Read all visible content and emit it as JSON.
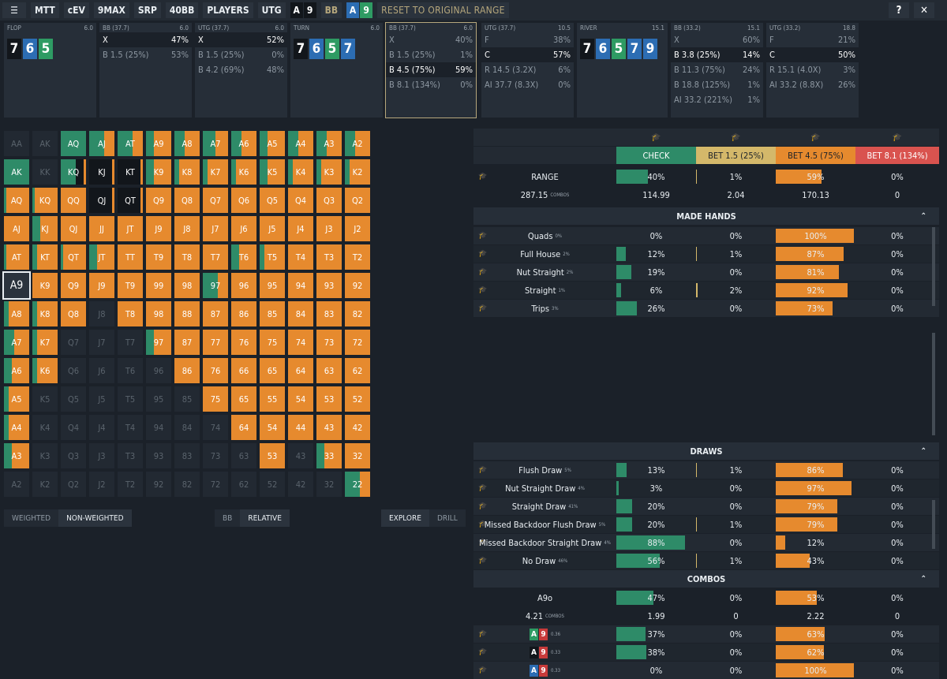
{
  "toolbar": {
    "menu_icon": "menu-icon",
    "buttons": [
      "MTT",
      "cEV",
      "9MAX",
      "SRP",
      "40BB",
      "PLAYERS",
      "UTG"
    ],
    "hand": [
      {
        "r": "A",
        "s": "s"
      },
      {
        "r": "9",
        "s": "s"
      }
    ],
    "pos2": "BB",
    "hand2": [
      {
        "r": "A",
        "s": "d"
      },
      {
        "r": "9",
        "s": "c"
      }
    ],
    "reset": "RESET TO ORIGINAL RANGE",
    "help": "?",
    "close": "✕"
  },
  "streets": [
    {
      "name": "FLOP",
      "val": "6.0",
      "cards": [
        {
          "r": "7",
          "s": "s"
        },
        {
          "r": "6",
          "s": "d"
        },
        {
          "r": "5",
          "s": "c"
        }
      ]
    },
    {
      "name": "BB (37.7)",
      "val": "6.0",
      "actions": [
        {
          "l": "X",
          "v": "47%",
          "sel": true
        },
        {
          "l": "B 1.5 (25%)",
          "v": "53%"
        }
      ]
    },
    {
      "name": "UTG (37.7)",
      "val": "6.0",
      "actions": [
        {
          "l": "X",
          "v": "52%",
          "sel": true
        },
        {
          "l": "B 1.5 (25%)",
          "v": "0%"
        },
        {
          "l": "B 4.2 (69%)",
          "v": "48%"
        }
      ]
    },
    {
      "name": "TURN",
      "val": "6.0",
      "cards": [
        {
          "r": "7",
          "s": "s"
        },
        {
          "r": "6",
          "s": "d"
        },
        {
          "r": "5",
          "s": "c"
        },
        {
          "r": "7",
          "s": "d"
        }
      ]
    },
    {
      "name": "BB (37.7)",
      "val": "6.0",
      "actions": [
        {
          "l": "X",
          "v": "40%"
        },
        {
          "l": "B 1.5 (25%)",
          "v": "1%"
        },
        {
          "l": "B 4.5 (75%)",
          "v": "59%",
          "sel": true
        },
        {
          "l": "B 8.1 (134%)",
          "v": "0%"
        }
      ]
    },
    {
      "name": "UTG (37.7)",
      "val": "10.5",
      "actions": [
        {
          "l": "F",
          "v": "38%"
        },
        {
          "l": "C",
          "v": "57%",
          "sel": true
        },
        {
          "l": "R 14.5 (3.2X)",
          "v": "6%"
        },
        {
          "l": "AI 37.7 (8.3X)",
          "v": "0%"
        }
      ]
    },
    {
      "name": "RIVER",
      "val": "15.1",
      "cards": [
        {
          "r": "7",
          "s": "s"
        },
        {
          "r": "6",
          "s": "d"
        },
        {
          "r": "5",
          "s": "c"
        },
        {
          "r": "7",
          "s": "d"
        },
        {
          "r": "9",
          "s": "d"
        }
      ]
    },
    {
      "name": "BB (33.2)",
      "val": "15.1",
      "actions": [
        {
          "l": "X",
          "v": "60%"
        },
        {
          "l": "B 3.8 (25%)",
          "v": "14%",
          "sel": true
        },
        {
          "l": "B 11.3 (75%)",
          "v": "24%"
        },
        {
          "l": "B 18.8 (125%)",
          "v": "1%"
        },
        {
          "l": "AI 33.2 (221%)",
          "v": "1%"
        }
      ]
    },
    {
      "name": "UTG (33.2)",
      "val": "18.8",
      "actions": [
        {
          "l": "F",
          "v": "21%"
        },
        {
          "l": "C",
          "v": "50%",
          "sel": true
        },
        {
          "l": "R 15.1 (4.0X)",
          "v": "3%"
        },
        {
          "l": "AI 33.2 (8.8X)",
          "v": "26%"
        }
      ]
    }
  ],
  "grid": {
    "rows": [
      [
        "AA",
        "AK",
        "AQ",
        "AJ",
        "AT",
        "A9",
        "A8",
        "A7",
        "A6",
        "A5",
        "A4",
        "A3",
        "A2"
      ],
      [
        "AK",
        "KK",
        "KQ",
        "KJ",
        "KT",
        "K9",
        "K8",
        "K7",
        "K6",
        "K5",
        "K4",
        "K3",
        "K2"
      ],
      [
        "AQ",
        "KQ",
        "QQ",
        "QJ",
        "QT",
        "Q9",
        "Q8",
        "Q7",
        "Q6",
        "Q5",
        "Q4",
        "Q3",
        "Q2"
      ],
      [
        "AJ",
        "KJ",
        "QJ",
        "JJ",
        "JT",
        "J9",
        "J8",
        "J7",
        "J6",
        "J5",
        "J4",
        "J3",
        "J2"
      ],
      [
        "AT",
        "KT",
        "QT",
        "JT",
        "TT",
        "T9",
        "T8",
        "T7",
        "T6",
        "T5",
        "T4",
        "T3",
        "T2"
      ],
      [
        "A9",
        "K9",
        "Q9",
        "J9",
        "T9",
        "99",
        "98",
        "97",
        "96",
        "95",
        "94",
        "93",
        "92"
      ],
      [
        "A8",
        "K8",
        "Q8",
        "J8",
        "T8",
        "98",
        "88",
        "87",
        "86",
        "85",
        "84",
        "83",
        "82"
      ],
      [
        "A7",
        "K7",
        "Q7",
        "J7",
        "T7",
        "97",
        "87",
        "77",
        "76",
        "75",
        "74",
        "73",
        "72"
      ],
      [
        "A6",
        "K6",
        "Q6",
        "J6",
        "T6",
        "96",
        "86",
        "76",
        "66",
        "65",
        "64",
        "63",
        "62"
      ],
      [
        "A5",
        "K5",
        "Q5",
        "J5",
        "T5",
        "95",
        "85",
        "75",
        "65",
        "55",
        "54",
        "53",
        "52"
      ],
      [
        "A4",
        "K4",
        "Q4",
        "J4",
        "T4",
        "94",
        "84",
        "74",
        "64",
        "54",
        "44",
        "43",
        "42"
      ],
      [
        "A3",
        "K3",
        "Q3",
        "J3",
        "T3",
        "93",
        "83",
        "73",
        "63",
        "53",
        "43",
        "33",
        "32"
      ],
      [
        "A2",
        "K2",
        "Q2",
        "J2",
        "T2",
        "92",
        "82",
        "72",
        "62",
        "52",
        "42",
        "32",
        "22"
      ]
    ],
    "check": [
      [
        0,
        0,
        1,
        0.6,
        0.6,
        0.3,
        0.4,
        0.5,
        0.4,
        0.3,
        0.4,
        0.4,
        0.4
      ],
      [
        1,
        0,
        0.6,
        0,
        0,
        0.3,
        0.2,
        0.2,
        0.2,
        0.3,
        0.2,
        0.2,
        0.2
      ],
      [
        0.1,
        0.1,
        0,
        0,
        0,
        0,
        0,
        0,
        0,
        0,
        0,
        0,
        0
      ],
      [
        0,
        0.3,
        0,
        0,
        0,
        0,
        0,
        0,
        0,
        0,
        0,
        0,
        0
      ],
      [
        0.1,
        0.2,
        0.1,
        0.3,
        0,
        0,
        0,
        0,
        0.3,
        0.2,
        0,
        0,
        0
      ],
      [
        0,
        0,
        0,
        0,
        0,
        0,
        0,
        0.6,
        0,
        0,
        0,
        0,
        0
      ],
      [
        0.2,
        0.2,
        0,
        0,
        0,
        0,
        0,
        0,
        0,
        0,
        0,
        0,
        0
      ],
      [
        0.4,
        0.2,
        0,
        0,
        0,
        0.3,
        0,
        0,
        0,
        0,
        0,
        0,
        0
      ],
      [
        0.3,
        0.2,
        0,
        0,
        0,
        0,
        0,
        0,
        0,
        0,
        0,
        0,
        0
      ],
      [
        0.2,
        0,
        0,
        0,
        0,
        0,
        0,
        0,
        0,
        0,
        0,
        0,
        0
      ],
      [
        0.2,
        0,
        0,
        0,
        0,
        0,
        0,
        0,
        0,
        0,
        0,
        0,
        0
      ],
      [
        0.3,
        0,
        0,
        0,
        0,
        0,
        0,
        0,
        0,
        0,
        0,
        0.3,
        0
      ],
      [
        0,
        0,
        0,
        0,
        0,
        0,
        0,
        0,
        0,
        0,
        0,
        0,
        0.6
      ]
    ],
    "empty": [
      [
        1,
        1,
        0,
        0,
        0,
        0,
        0,
        0,
        0,
        0,
        0,
        0,
        0
      ],
      [
        0,
        1,
        0,
        0,
        0,
        0,
        0,
        0,
        0,
        0,
        0,
        0,
        0
      ],
      [
        0,
        0,
        0,
        0,
        0,
        0,
        0,
        0,
        0,
        0,
        0,
        0,
        0
      ],
      [
        0,
        0,
        0,
        0,
        0,
        0,
        0,
        0,
        0,
        0,
        0,
        0,
        0
      ],
      [
        0,
        0,
        0,
        0,
        0,
        0,
        0,
        0,
        0,
        0,
        0,
        0,
        0
      ],
      [
        0,
        0,
        0,
        0,
        0,
        0,
        0,
        0,
        0,
        0,
        0,
        0,
        0
      ],
      [
        0,
        0,
        0,
        1,
        0,
        0,
        0,
        0,
        0,
        0,
        0,
        0,
        0
      ],
      [
        0,
        0,
        1,
        1,
        1,
        0,
        0,
        0,
        0,
        0,
        0,
        0,
        0
      ],
      [
        0,
        0,
        1,
        1,
        1,
        1,
        0,
        0,
        0,
        0,
        0,
        0,
        0
      ],
      [
        0,
        1,
        1,
        1,
        1,
        1,
        1,
        0,
        0,
        0,
        0,
        0,
        0
      ],
      [
        0,
        1,
        1,
        1,
        1,
        1,
        1,
        1,
        0,
        0,
        0,
        0,
        0
      ],
      [
        0,
        1,
        1,
        1,
        1,
        1,
        1,
        1,
        1,
        0,
        1,
        0,
        0
      ],
      [
        1,
        1,
        1,
        1,
        1,
        1,
        1,
        1,
        1,
        1,
        1,
        1,
        0
      ]
    ],
    "dark_mixed": [
      [
        1,
        2
      ],
      [
        1,
        3
      ],
      [
        1,
        4
      ],
      [
        2,
        3
      ],
      [
        2,
        4
      ]
    ],
    "selected": "A9"
  },
  "bottom": {
    "weighted": "WEIGHTED",
    "nonweighted": "NON-WEIGHTED",
    "bb": "BB",
    "relative": "RELATIVE",
    "explore": "EXPLORE",
    "drill": "DRILL"
  },
  "table": {
    "headers": [
      "CHECK",
      "BET 1.5 (25%)",
      "BET 4.5 (75%)",
      "BET 8.1 (134%)"
    ],
    "header_colors": [
      "#2e8b68",
      "#d4b86a",
      "#e68a2e",
      "#d9534f"
    ],
    "range": {
      "label": "RANGE",
      "vals": [
        "40%",
        "1%",
        "59%",
        "0%"
      ],
      "combos": "287.15",
      "combos_label": "COMBOS",
      "combovals": [
        "114.99",
        "2.04",
        "170.13",
        "0"
      ]
    },
    "made_title": "MADE HANDS",
    "made": [
      {
        "n": "Quads",
        "p": "0%",
        "v": [
          "0%",
          "0%",
          "100%",
          "0%"
        ]
      },
      {
        "n": "Full House",
        "p": "2%",
        "v": [
          "12%",
          "1%",
          "87%",
          "0%"
        ]
      },
      {
        "n": "Nut Straight",
        "p": "2%",
        "v": [
          "19%",
          "0%",
          "81%",
          "0%"
        ]
      },
      {
        "n": "Straight",
        "p": "1%",
        "v": [
          "6%",
          "2%",
          "92%",
          "0%"
        ]
      },
      {
        "n": "Trips",
        "p": "3%",
        "v": [
          "26%",
          "0%",
          "73%",
          "0%"
        ]
      }
    ],
    "draws_title": "DRAWS",
    "draws": [
      {
        "n": "Flush Draw",
        "p": "5%",
        "v": [
          "13%",
          "1%",
          "86%",
          "0%"
        ]
      },
      {
        "n": "Nut Straight Draw",
        "p": "4%",
        "v": [
          "3%",
          "0%",
          "97%",
          "0%"
        ]
      },
      {
        "n": "Straight Draw",
        "p": "41%",
        "v": [
          "20%",
          "0%",
          "79%",
          "0%"
        ]
      },
      {
        "n": "Missed Backdoor Flush Draw",
        "p": "5%",
        "v": [
          "20%",
          "1%",
          "79%",
          "0%"
        ]
      },
      {
        "n": "Missed Backdoor Straight Draw",
        "p": "4%",
        "v": [
          "88%",
          "0%",
          "12%",
          "0%"
        ]
      },
      {
        "n": "No Draw",
        "p": "46%",
        "v": [
          "56%",
          "1%",
          "43%",
          "0%"
        ]
      }
    ],
    "combos_title": "COMBOS",
    "hand": {
      "label": "A9o",
      "vals": [
        "47%",
        "0%",
        "53%",
        "0%"
      ],
      "combos": "4.21",
      "combos_label": "COMBOS",
      "combovals": [
        "1.99",
        "0",
        "2.22",
        "0"
      ]
    },
    "combos": [
      {
        "c": [
          {
            "r": "A",
            "s": "c"
          },
          {
            "r": "9",
            "s": "h"
          }
        ],
        "w": "0.36",
        "v": [
          "37%",
          "0%",
          "63%",
          "0%"
        ]
      },
      {
        "c": [
          {
            "r": "A",
            "s": "s"
          },
          {
            "r": "9",
            "s": "h"
          }
        ],
        "w": "0.33",
        "v": [
          "38%",
          "0%",
          "62%",
          "0%"
        ]
      },
      {
        "c": [
          {
            "r": "A",
            "s": "d"
          },
          {
            "r": "9",
            "s": "h"
          }
        ],
        "w": "0.33",
        "v": [
          "0%",
          "0%",
          "100%",
          "0%"
        ]
      }
    ]
  }
}
